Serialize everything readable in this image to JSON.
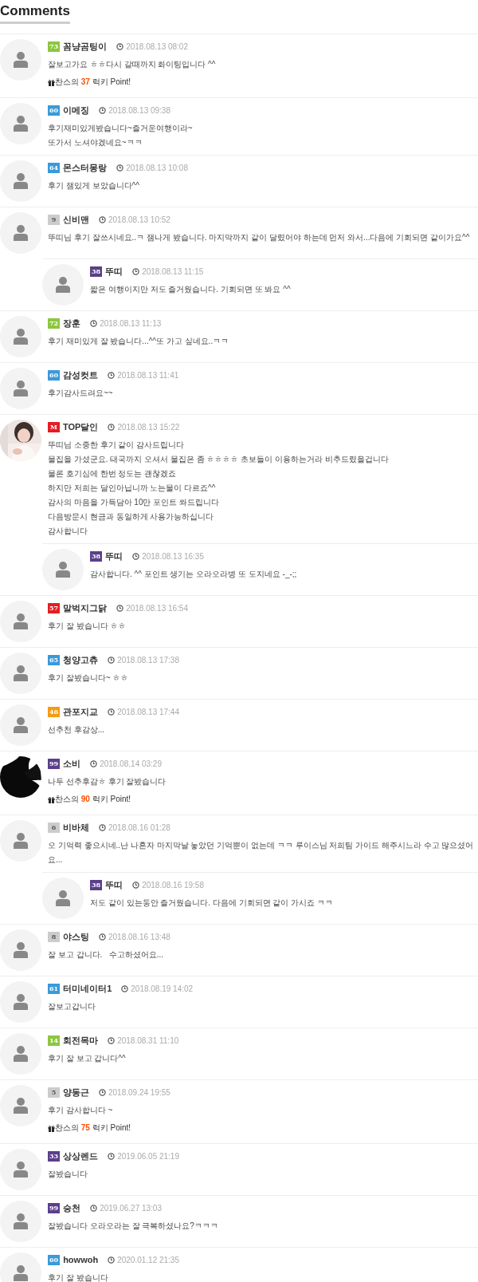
{
  "title": "Comments",
  "comments": [
    {
      "level": "73",
      "color": "#8dc63f",
      "name": "꼼냥곰팅이",
      "date": "2018.08.13 08:02",
      "kind": "default",
      "lines": [
        "잘보고가요 ㅎㅎ다시 갈때까지 화이팅입니다 ^^"
      ],
      "lucky": {
        "prefix": "찬스의",
        "points": "37",
        "suffix": "럭키 Point!"
      }
    },
    {
      "level": "60",
      "color": "#3a9ad9",
      "name": "이메징",
      "date": "2018.08.13 09:38",
      "kind": "default",
      "lines": [
        "후기재미있게봤습니다~즐거운여행이라~",
        "또가서 노셔야겠네요~ㅋㅋ"
      ]
    },
    {
      "level": "64",
      "color": "#3a9ad9",
      "name": "몬스터몽랑",
      "date": "2018.08.13 10:08",
      "kind": "default",
      "lines": [
        "후기 잼있게 보았습니다^^"
      ]
    },
    {
      "level": "9",
      "color": "#cccccc",
      "name": "신비맨",
      "date": "2018.08.13 10:52",
      "kind": "default",
      "lines": [
        "뚜띠님 후기 잘쓰시네요..ㅋ 잼나게 봤습니다. 마지막까지 같이 달렸어야 하는데 먼저 와서...다음에 기회되면 같이가요^^"
      ],
      "replies": [
        {
          "level": "38",
          "color": "#5b3f8c",
          "name": "뚜띠",
          "date": "2018.08.13 11:15",
          "kind": "default",
          "lines": [
            "짧은 여행이지만 저도 즐거웠습니다. 기회되면 또 봐요 ^^"
          ]
        }
      ]
    },
    {
      "level": "72",
      "color": "#8dc63f",
      "name": "장훈",
      "date": "2018.08.13 11:13",
      "kind": "default",
      "lines": [
        "후기 재미있게 잘 봤습니다...^^또 가고 싶네요..ㅋㅋ"
      ]
    },
    {
      "level": "60",
      "color": "#3a9ad9",
      "name": "감성컷트",
      "date": "2018.08.13 11:41",
      "kind": "default",
      "lines": [
        "후기감사드려요~~"
      ]
    },
    {
      "level": "M",
      "color": "#e31e24",
      "name": "TOP달인",
      "date": "2018.08.13 15:22",
      "kind": "picture",
      "lines": [
        "뚜띠님 소중한 후기 같이 감사드립니다",
        "물집을 가셨군요. 태국까지 오셔서 물집은 좀 ㅎㅎㅎㅎ 초보들이 이용하는거라 비추드렸을겁니다",
        "물론 호기심에 한번 정도는 괜찮겠죠",
        "하지만 저희는 달인아닙니까 노는물이 다르죠^^",
        "감사의 마음을 가득담아 10만 포인트 쏴드립니다",
        "다음방문시 현금과 동일하게 사용가능하십니다",
        "감사합니다"
      ],
      "replies": [
        {
          "level": "38",
          "color": "#5b3f8c",
          "name": "뚜띠",
          "date": "2018.08.13 16:35",
          "kind": "default",
          "lines": [
            "감사합니다. ^^ 포인트 생기는 오라오라병 또 도지네요 -_-;;"
          ]
        }
      ]
    },
    {
      "level": "57",
      "color": "#e31e24",
      "name": "말벅지그닭",
      "date": "2018.08.13 16:54",
      "kind": "default",
      "lines": [
        "후기 잘 봤습니다 ㅎㅎ"
      ]
    },
    {
      "level": "65",
      "color": "#3a9ad9",
      "name": "청양고츄",
      "date": "2018.08.13 17:38",
      "kind": "default",
      "lines": [
        "후기 잘봤습니다~ ㅎㅎ"
      ]
    },
    {
      "level": "46",
      "color": "#f39c12",
      "name": "관포지교",
      "date": "2018.08.13 17:44",
      "kind": "default",
      "lines": [
        "선추천 후감상..."
      ]
    },
    {
      "level": "99",
      "color": "#5b3f8c",
      "name": "소비",
      "date": "2018.08.14 03:29",
      "kind": "picture",
      "lines": [
        "나두 선추후감ㅎ 후기 잘봤습니다"
      ],
      "lucky": {
        "prefix": "찬스의",
        "points": "90",
        "suffix": "럭키 Point!"
      }
    },
    {
      "level": "6",
      "color": "#cccccc",
      "name": "비바체",
      "date": "2018.08.16 01:28",
      "kind": "default",
      "lines": [
        "오 기억력 좋으시네..난 나혼자 마지막날 놓았던 기억뿐이 없는데 ㅋㅋ 루이스님 저희팀 가이드 해주시느라 수고 많으셨어요..."
      ],
      "replies": [
        {
          "level": "38",
          "color": "#5b3f8c",
          "name": "뚜띠",
          "date": "2018.08.16 19:58",
          "kind": "default",
          "lines": [
            "저도 같이 있는동안 즐거웠습니다. 다음에 기회되면 같이 가시죠 ㅋㅋ"
          ]
        }
      ]
    },
    {
      "level": "8",
      "color": "#cccccc",
      "name": "야스팅",
      "date": "2018.08.16 13:48",
      "kind": "default",
      "lines": [
        "잘 보고 갑니다.   수고하셨어요..."
      ]
    },
    {
      "level": "61",
      "color": "#3a9ad9",
      "name": "터미네이터1",
      "date": "2018.08.19 14:02",
      "kind": "default",
      "lines": [
        "잘보고갑니다"
      ]
    },
    {
      "level": "14",
      "color": "#8dc63f",
      "name": "회전목마",
      "date": "2018.08.31 11:10",
      "kind": "default",
      "lines": [
        "후기 잘 보고 갑니다^^"
      ]
    },
    {
      "level": "5",
      "color": "#cccccc",
      "name": "양동근",
      "date": "2018.09.24 19:55",
      "kind": "default",
      "lines": [
        "후기 감사합니다 ~"
      ],
      "lucky": {
        "prefix": "찬스의",
        "points": "75",
        "suffix": "럭키 Point!"
      }
    },
    {
      "level": "33",
      "color": "#5b3f8c",
      "name": "상상렌드",
      "date": "2019.06.05 21:19",
      "kind": "default",
      "lines": [
        "잘봤습니다"
      ]
    },
    {
      "level": "99",
      "color": "#5b3f8c",
      "name": "승천",
      "date": "2019.06.27 13:03",
      "kind": "default",
      "lines": [
        "잘봤습니다 오라오라는 잘 극복하셨나요?ㅋㅋㅋ"
      ]
    },
    {
      "level": "60",
      "color": "#3a9ad9",
      "name": "howwoh",
      "date": "2020.01.12 21:35",
      "kind": "default",
      "lines": [
        "후기 잘 봤습니다"
      ]
    }
  ]
}
